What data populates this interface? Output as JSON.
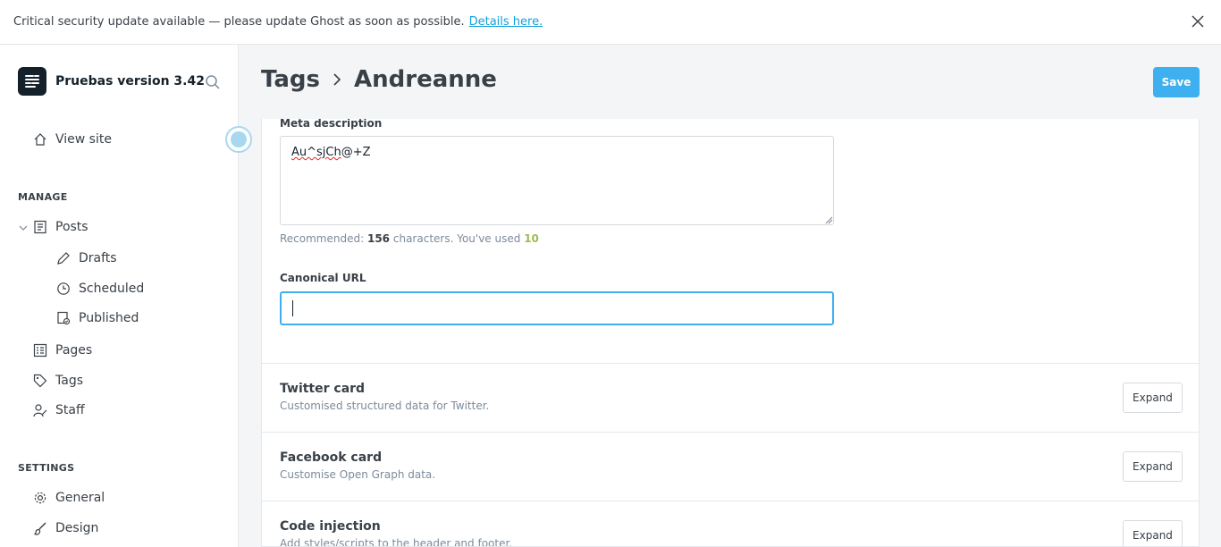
{
  "banner": {
    "message": "Critical security update available — please update Ghost as soon as possible.",
    "link_label": "Details here."
  },
  "sidebar": {
    "site_name": "Pruebas version 3.42",
    "view_site": "View site",
    "manage_label": "MANAGE",
    "posts": "Posts",
    "drafts": "Drafts",
    "scheduled": "Scheduled",
    "published": "Published",
    "pages": "Pages",
    "tags": "Tags",
    "staff": "Staff",
    "settings_label": "SETTINGS",
    "general": "General",
    "design": "Design"
  },
  "header": {
    "breadcrumb_parent": "Tags",
    "breadcrumb_current": "Andreanne",
    "save_label": "Save"
  },
  "meta": {
    "description_label": "Meta description",
    "description_value": "Au^sjCh@+Z",
    "description_typo": "Au^sjCh",
    "description_rest": "@+Z",
    "hint_prefix": "Recommended:",
    "hint_recommended": "156",
    "hint_middle": "characters. You've used",
    "hint_used": "10",
    "canonical_label": "Canonical URL",
    "canonical_value": ""
  },
  "cards": [
    {
      "title": "Twitter card",
      "subtitle": "Customised structured data for Twitter.",
      "button": "Expand"
    },
    {
      "title": "Facebook card",
      "subtitle": "Customise Open Graph data.",
      "button": "Expand"
    },
    {
      "title": "Code injection",
      "subtitle": "Add styles/scripts to the header and footer.",
      "button": "Expand"
    }
  ],
  "colors": {
    "accent": "#3eb0ef",
    "link": "#14a0dc",
    "used_count": "#9fbb58",
    "logo_bg": "#15212a"
  }
}
